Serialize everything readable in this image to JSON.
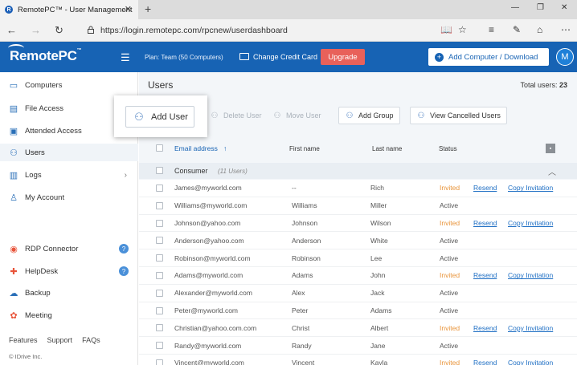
{
  "browser": {
    "tab_title": "RemotePC™ - User Management",
    "tab_favicon": "R",
    "url": "https://login.remotepc.com/rpcnew/userdashboard"
  },
  "header": {
    "logo": "RemotePC",
    "logo_mark": "™",
    "plan": "Plan: Team (50 Computers)",
    "change_card": "Change Credit Card",
    "upgrade": "Upgrade",
    "add_computer": "Add Computer / Download",
    "avatar": "M"
  },
  "sidebar": {
    "items": [
      {
        "label": "Computers",
        "icon": "monitor-icon"
      },
      {
        "label": "File Access",
        "icon": "file-icon"
      },
      {
        "label": "Attended Access",
        "icon": "attended-icon"
      },
      {
        "label": "Users",
        "icon": "users-icon"
      },
      {
        "label": "Logs",
        "icon": "logs-icon"
      },
      {
        "label": "My Account",
        "icon": "account-icon"
      },
      {
        "label": "RDP Connector",
        "icon": "rdp-icon"
      },
      {
        "label": "HelpDesk",
        "icon": "helpdesk-icon"
      },
      {
        "label": "Backup",
        "icon": "backup-icon"
      },
      {
        "label": "Meeting",
        "icon": "meeting-icon"
      }
    ],
    "footer": {
      "features": "Features",
      "support": "Support",
      "faqs": "FAQs",
      "copyright": "© IDrive Inc."
    }
  },
  "main": {
    "title": "Users",
    "total_label": "Total users: ",
    "total_value": "23",
    "toolbar": {
      "add_user": "Add User",
      "delete_user": "Delete User",
      "move_user": "Move User",
      "add_group": "Add Group",
      "view_cancelled": "View Cancelled Users"
    },
    "columns": {
      "email": "Email address",
      "sort_arrow": "↑",
      "first": "First name",
      "last": "Last name",
      "status": "Status"
    },
    "group": {
      "name": "Consumer",
      "count": "(11 Users)"
    },
    "rows": [
      {
        "email": "James@myworld.com",
        "first": "--",
        "last": "Rich",
        "status": "Invited",
        "resend": "Resend",
        "copy": "Copy Invitation"
      },
      {
        "email": "Williams@myworld.com",
        "first": "Williams",
        "last": "Miller",
        "status": "Active",
        "resend": "",
        "copy": ""
      },
      {
        "email": "Johnson@yahoo.com",
        "first": "Johnson",
        "last": "Wilson",
        "status": "Invited",
        "resend": "Resend",
        "copy": "Copy Invitation"
      },
      {
        "email": "Anderson@yahoo.com",
        "first": "Anderson",
        "last": "White",
        "status": "Active",
        "resend": "",
        "copy": ""
      },
      {
        "email": "Robinson@myworld.com",
        "first": "Robinson",
        "last": "Lee",
        "status": "Active",
        "resend": "",
        "copy": ""
      },
      {
        "email": "Adams@myworld.com",
        "first": "Adams",
        "last": "John",
        "status": "Invited",
        "resend": "Resend",
        "copy": "Copy Invitation"
      },
      {
        "email": "Alexander@myworld.com",
        "first": "Alex",
        "last": "Jack",
        "status": "Active",
        "resend": "",
        "copy": ""
      },
      {
        "email": "Peter@myworld.com",
        "first": "Peter",
        "last": "Adams",
        "status": "Active",
        "resend": "",
        "copy": ""
      },
      {
        "email": "Christian@yahoo.com.com",
        "first": "Christ",
        "last": "Albert",
        "status": "Invited",
        "resend": "Resend",
        "copy": "Copy Invitation"
      },
      {
        "email": "Randy@myworld.com",
        "first": "Randy",
        "last": "Jane",
        "status": "Active",
        "resend": "",
        "copy": ""
      },
      {
        "email": "Vincent@myworld.com",
        "first": "Vincent",
        "last": "Kayla",
        "status": "Invited",
        "resend": "Resend",
        "copy": "Copy Invitation"
      }
    ]
  },
  "colors": {
    "brand": "#1763b4",
    "upgrade": "#e8615a",
    "invited": "#e8943a",
    "link": "#1f6fc4"
  }
}
